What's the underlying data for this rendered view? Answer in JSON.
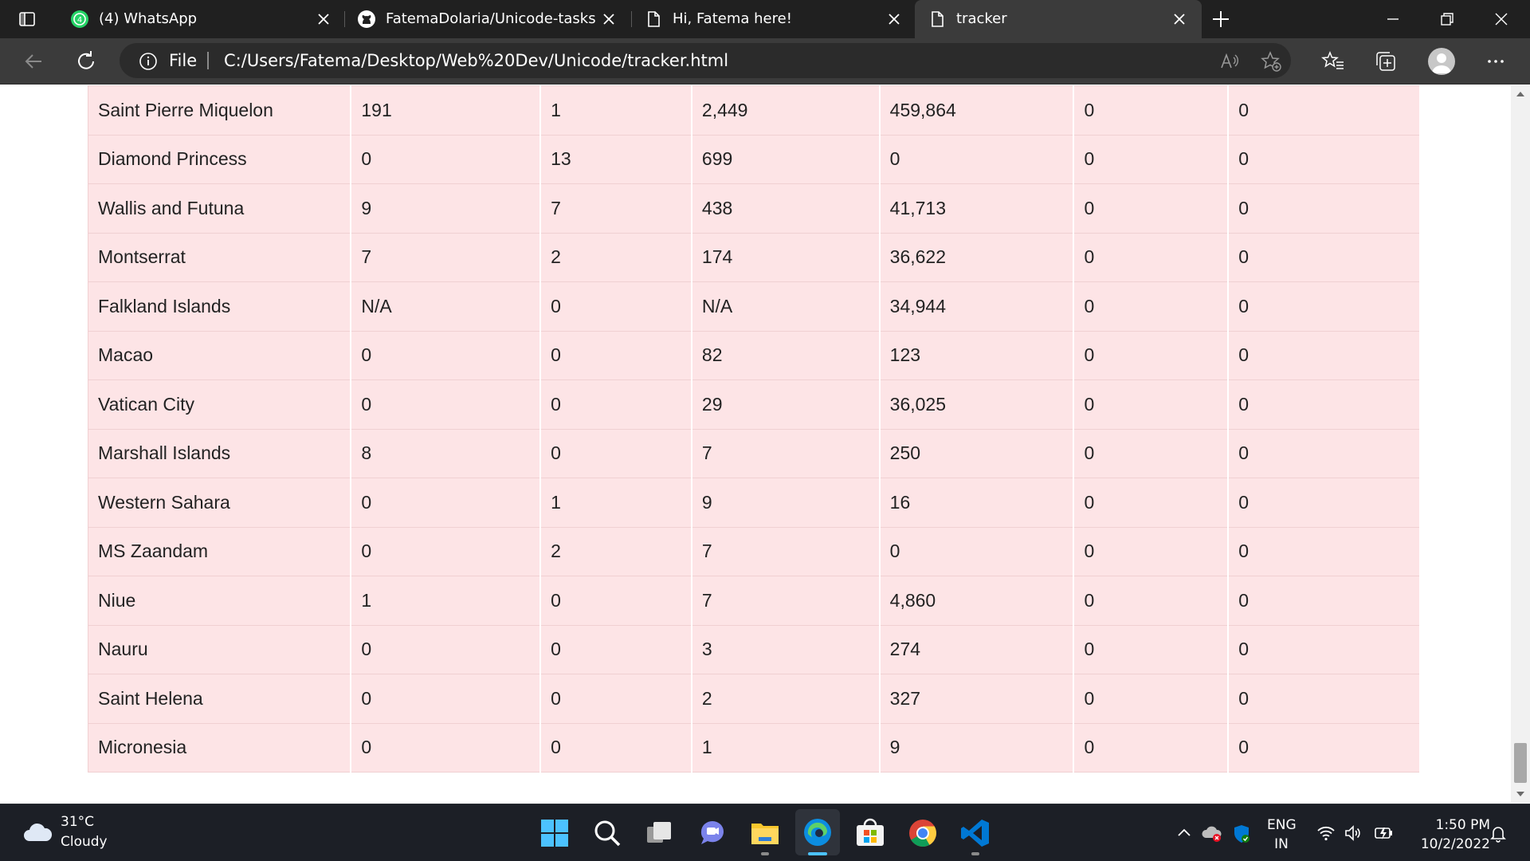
{
  "browser": {
    "tabs": [
      {
        "title": "(4) WhatsApp",
        "icon": "whatsapp-icon",
        "badge": "4"
      },
      {
        "title": "FatemaDolaria/Unicode-tasks",
        "icon": "github-icon"
      },
      {
        "title": "Hi, Fatema here!",
        "icon": "page-icon"
      },
      {
        "title": "tracker",
        "icon": "page-icon",
        "active": true
      }
    ],
    "address": {
      "scheme_label": "File",
      "url": "C:/Users/Fatema/Desktop/Web%20Dev/Unicode/tracker.html"
    },
    "read_aloud_icon": "A⁾"
  },
  "table": {
    "rows": [
      [
        "Saint Pierre Miquelon",
        "191",
        "1",
        "2,449",
        "459,864",
        "0",
        "0"
      ],
      [
        "Diamond Princess",
        "0",
        "13",
        "699",
        "0",
        "0",
        "0"
      ],
      [
        "Wallis and Futuna",
        "9",
        "7",
        "438",
        "41,713",
        "0",
        "0"
      ],
      [
        "Montserrat",
        "7",
        "2",
        "174",
        "36,622",
        "0",
        "0"
      ],
      [
        "Falkland Islands",
        "N/A",
        "0",
        "N/A",
        "34,944",
        "0",
        "0"
      ],
      [
        "Macao",
        "0",
        "0",
        "82",
        "123",
        "0",
        "0"
      ],
      [
        "Vatican City",
        "0",
        "0",
        "29",
        "36,025",
        "0",
        "0"
      ],
      [
        "Marshall Islands",
        "8",
        "0",
        "7",
        "250",
        "0",
        "0"
      ],
      [
        "Western Sahara",
        "0",
        "1",
        "9",
        "16",
        "0",
        "0"
      ],
      [
        "MS Zaandam",
        "0",
        "2",
        "7",
        "0",
        "0",
        "0"
      ],
      [
        "Niue",
        "1",
        "0",
        "7",
        "4,860",
        "0",
        "0"
      ],
      [
        "Nauru",
        "0",
        "0",
        "3",
        "274",
        "0",
        "0"
      ],
      [
        "Saint Helena",
        "0",
        "0",
        "2",
        "327",
        "0",
        "0"
      ],
      [
        "Micronesia",
        "0",
        "0",
        "1",
        "9",
        "0",
        "0"
      ]
    ],
    "colors": {
      "row_bg": "#fde4e6"
    }
  },
  "taskbar": {
    "weather": {
      "temp": "31°C",
      "desc": "Cloudy"
    },
    "language": {
      "line1": "ENG",
      "line2": "IN"
    },
    "clock": {
      "time": "1:50 PM",
      "date": "10/2/2022"
    }
  }
}
